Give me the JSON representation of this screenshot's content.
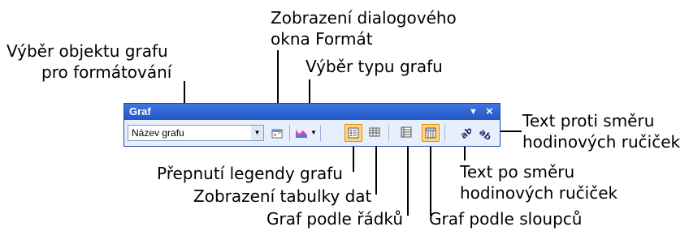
{
  "toolbar": {
    "title": "Graf",
    "object_select": {
      "value": "Název grafu"
    }
  },
  "icons": [
    "format-dialog-icon",
    "chart-type-icon",
    "legend-icon",
    "data-table-icon",
    "by-row-icon",
    "by-column-icon",
    "angle-clockwise-icon",
    "angle-counterclockwise-icon"
  ],
  "callouts": {
    "object_select_1": "Výběr objektu grafu",
    "object_select_2": "pro formátování",
    "format_dialog_1": "Zobrazení dialogového",
    "format_dialog_2": "okna Formát",
    "chart_type": "Výběr typu grafu",
    "angle_ccw_1": "Text proti směru",
    "angle_ccw_2": "hodinových ručiček",
    "legend": "Přepnutí legendy grafu",
    "data_table": "Zobrazení tabulky dat",
    "by_row": "Graf podle řádků",
    "by_column": "Graf podle sloupců",
    "angle_cw_1": "Text po směru",
    "angle_cw_2": "hodinových ručiček"
  },
  "colors": {
    "titlebar": "#2456c6",
    "toolbar_bg": "#e7eefc",
    "active_bg": "#ffd67a"
  }
}
